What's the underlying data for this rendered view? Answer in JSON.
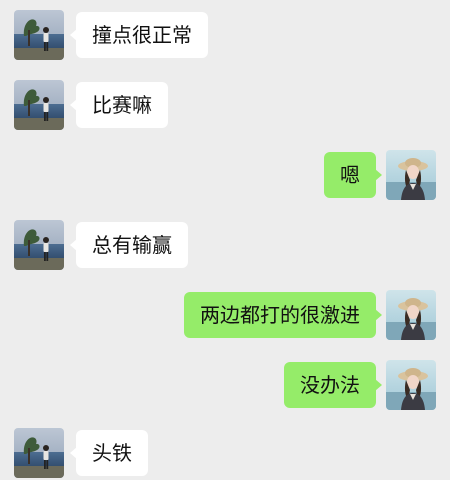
{
  "messages": [
    {
      "side": "left",
      "text": "撞点很正常",
      "avatar": "contact-avatar"
    },
    {
      "side": "left",
      "text": "比赛嘛",
      "avatar": "contact-avatar"
    },
    {
      "side": "right",
      "text": "嗯",
      "avatar": "self-avatar"
    },
    {
      "side": "left",
      "text": "总有输赢",
      "avatar": "contact-avatar"
    },
    {
      "side": "right",
      "text": "两边都打的很激进",
      "avatar": "self-avatar"
    },
    {
      "side": "right",
      "text": "没办法",
      "avatar": "self-avatar"
    },
    {
      "side": "left",
      "text": "头铁",
      "avatar": "contact-avatar"
    }
  ],
  "colors": {
    "background": "#ededed",
    "incoming_bubble": "#ffffff",
    "outgoing_bubble": "#95ec69"
  }
}
